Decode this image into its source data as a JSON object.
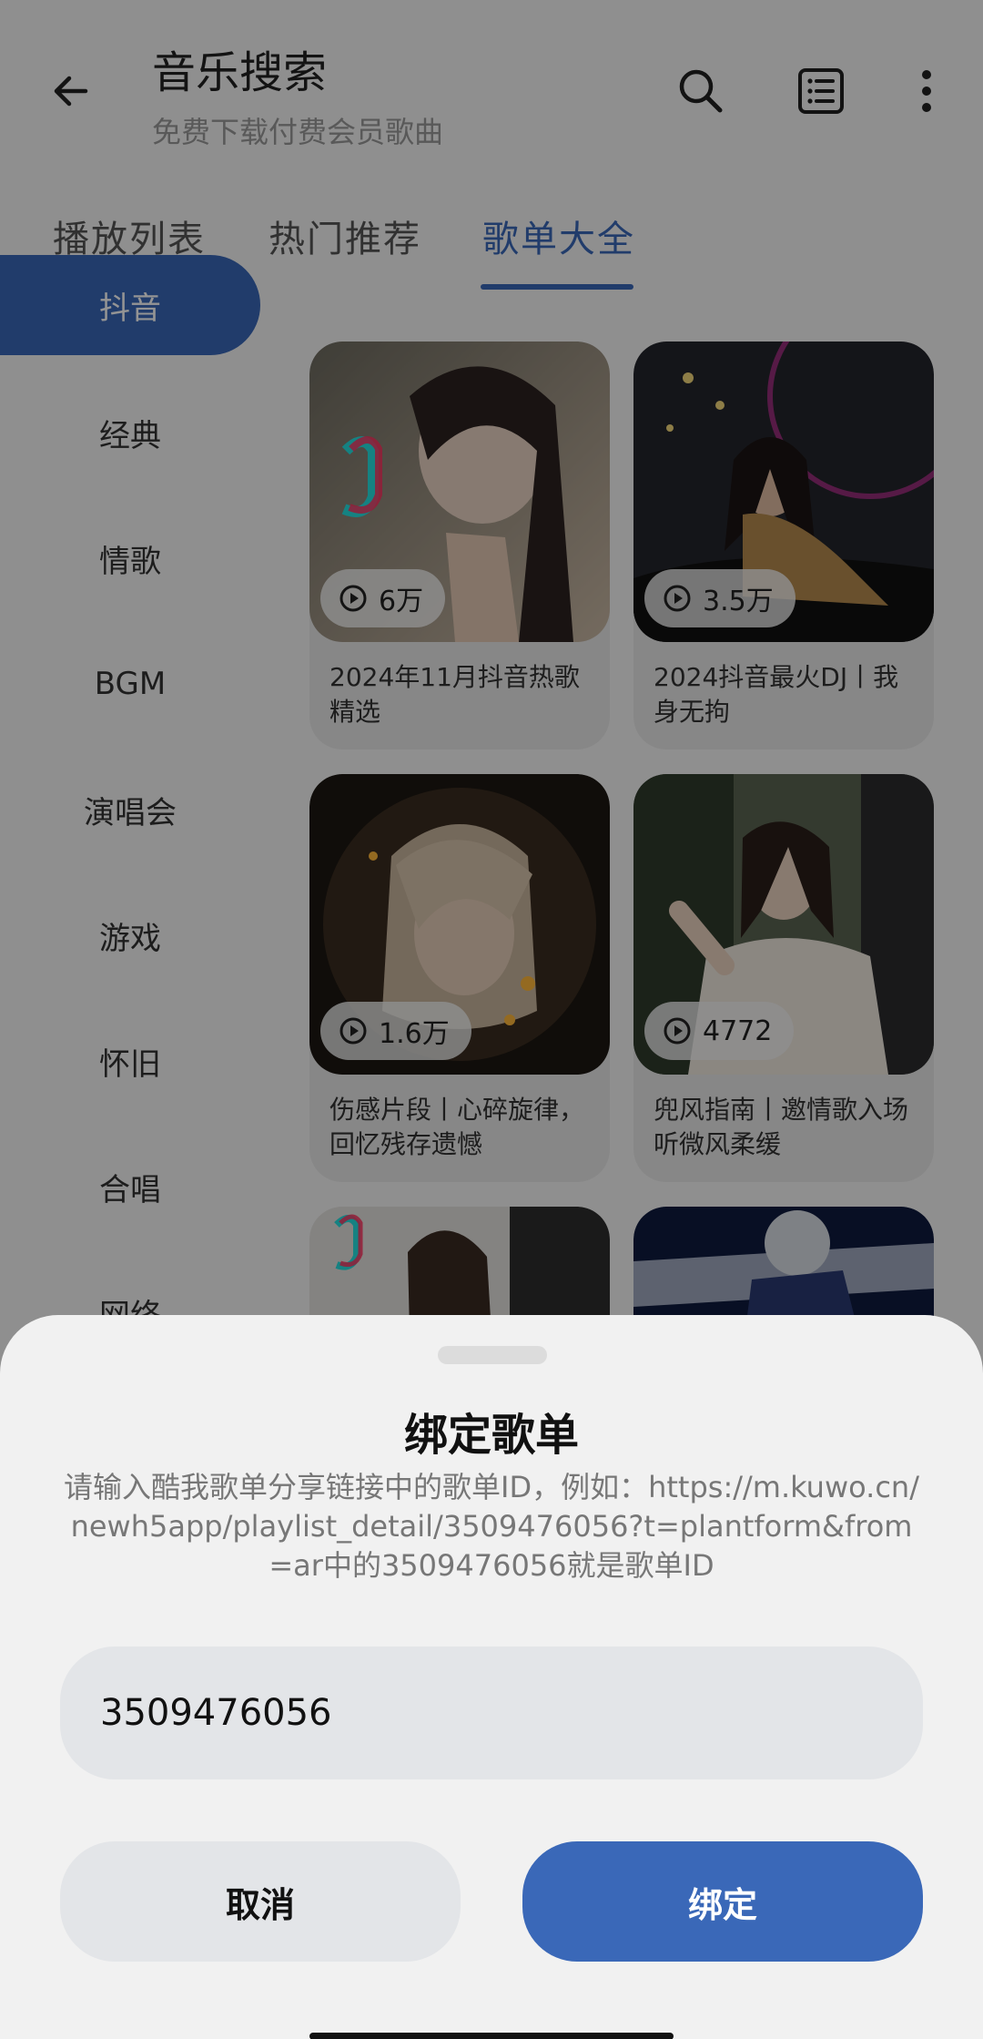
{
  "header": {
    "title": "音乐搜索",
    "subtitle": "免费下载付费会员歌曲",
    "icons": [
      "back-icon",
      "search-icon",
      "list-icon",
      "more-icon"
    ]
  },
  "tabs": [
    {
      "label": "播放列表",
      "active": false
    },
    {
      "label": "热门推荐",
      "active": false
    },
    {
      "label": "歌单大全",
      "active": true
    }
  ],
  "sidebar": {
    "items": [
      {
        "label": "抖音",
        "active": true
      },
      {
        "label": "经典",
        "active": false
      },
      {
        "label": "情歌",
        "active": false
      },
      {
        "label": "BGM",
        "active": false
      },
      {
        "label": "演唱会",
        "active": false
      },
      {
        "label": "游戏",
        "active": false
      },
      {
        "label": "怀旧",
        "active": false
      },
      {
        "label": "合唱",
        "active": false
      },
      {
        "label": "网络",
        "active": false
      }
    ]
  },
  "playlists": [
    {
      "plays": "6万",
      "title": "2024年11月抖音热歌精选"
    },
    {
      "plays": "3.5万",
      "title": "2024抖音最火DJ丨我身无拘"
    },
    {
      "plays": "1.6万",
      "title": "伤感片段丨心碎旋律，回忆残存遗憾"
    },
    {
      "plays": "4772",
      "title": "兜风指南丨邀情歌入场听微风柔缓"
    },
    {
      "plays": "",
      "title": ""
    },
    {
      "plays": "",
      "title": ""
    }
  ],
  "dialog": {
    "title": "绑定歌单",
    "description": "请输入酷我歌单分享链接中的歌单ID，例如：https://m.kuwo.cn/newh5app/playlist_detail/3509476056?t=plantform&from=ar中的3509476056就是歌单ID",
    "input_value": "3509476056",
    "cancel_label": "取消",
    "confirm_label": "绑定"
  },
  "colors": {
    "accent": "#3a68b8",
    "background": "#f7f7f7",
    "sheet": "#f1f1f1",
    "input": "#e3e5e8"
  }
}
